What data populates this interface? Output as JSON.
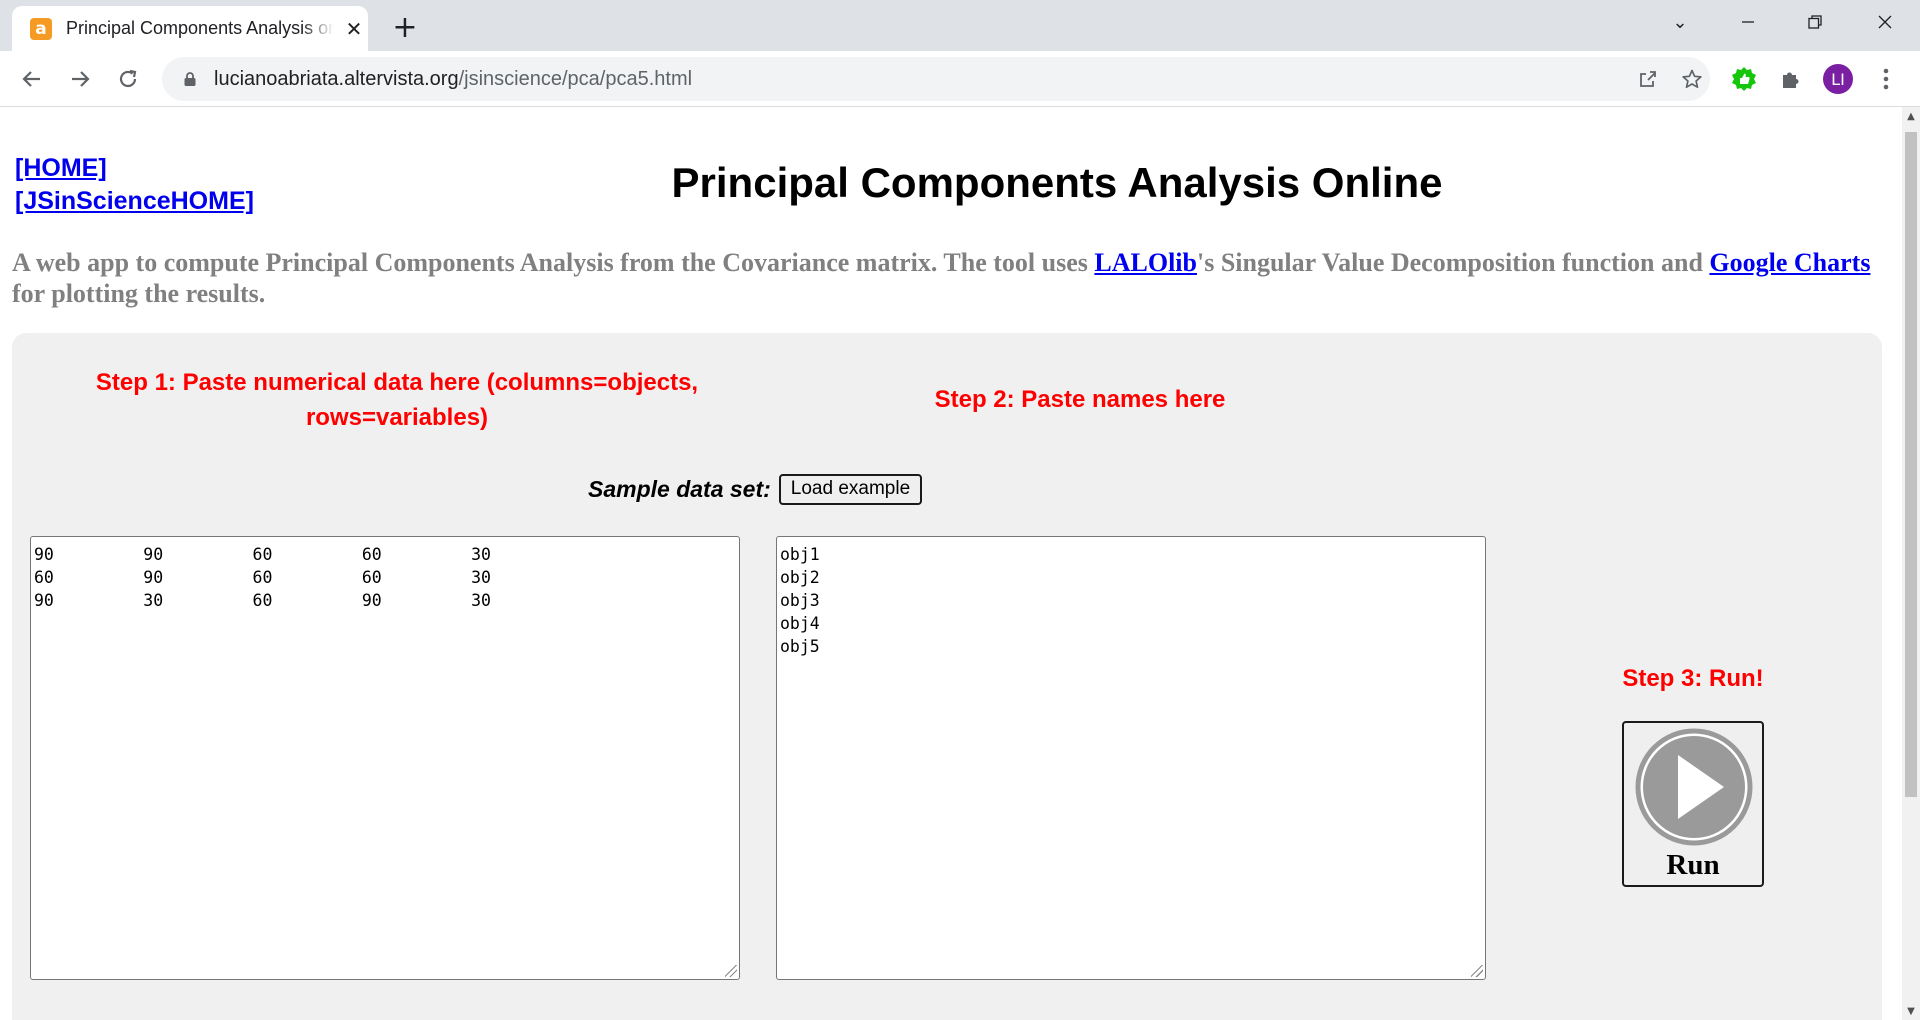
{
  "browser": {
    "tab_title": "Principal Components Analysis online",
    "tab_favicon": "a",
    "url_host": "lucianoabriata.altervista.org",
    "url_path": "/jsinscience/pca/pca5.html",
    "profile_initials": "LI"
  },
  "page": {
    "links": {
      "home": "[HOME]",
      "jsinscience_home": "[JSinScienceHOME]"
    },
    "title": "Principal Components Analysis Online",
    "intro": {
      "before_lalolib": "A web app to compute Principal Components Analysis from the Covariance matrix. The tool uses ",
      "lalolib": "LALOlib",
      "between": "'s Singular Value Decomposition function and ",
      "google_charts": "Google Charts",
      "after": " for plotting the results."
    },
    "step1": "Step 1: Paste numerical data here (columns=objects, rows=variables)",
    "step2": "Step 2: Paste names here",
    "step3": "Step 3: Run!",
    "sample_label": "Sample data set:",
    "load_button": "Load example",
    "data_text": "90\t90\t60\t60\t30\n60\t90\t60\t60\t30\n90\t30\t60\t90\t30",
    "names_text": "obj1\nobj2\nobj3\nobj4\nobj5",
    "run_label": "Run"
  },
  "icons": {
    "favicon": "altervista-icon",
    "lock": "lock-icon",
    "share": "share-icon",
    "bookmark": "star-icon",
    "extension_green": "thumbs-up-extension-icon",
    "extensions": "puzzle-icon",
    "menu": "kebab-menu-icon",
    "run": "play-circle-icon"
  },
  "colors": {
    "step_labels": "#ff0000",
    "intro_text": "#808080",
    "link": "#0000ee",
    "panel_bg": "#f0f0f0",
    "avatar_bg": "#7b1fa2",
    "extension_green": "#16c60c"
  }
}
